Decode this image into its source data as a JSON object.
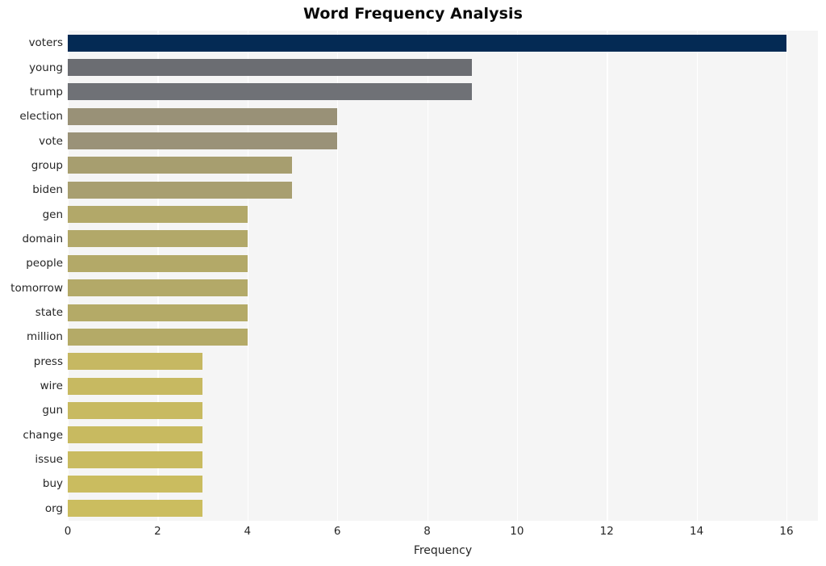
{
  "chart_data": {
    "type": "bar",
    "orientation": "horizontal",
    "title": "Word Frequency Analysis",
    "xlabel": "Frequency",
    "ylabel": "",
    "xlim": [
      0,
      16.7
    ],
    "ylim": [
      0,
      20
    ],
    "grid": true,
    "legend": null,
    "xticks": [
      "0",
      "2",
      "4",
      "6",
      "8",
      "10",
      "12",
      "14",
      "16"
    ],
    "xtick_values": [
      0,
      2,
      4,
      6,
      8,
      10,
      12,
      14,
      16
    ],
    "categories": [
      "voters",
      "young",
      "trump",
      "election",
      "vote",
      "group",
      "biden",
      "gen",
      "domain",
      "people",
      "tomorrow",
      "state",
      "million",
      "press",
      "wire",
      "gun",
      "change",
      "issue",
      "buy",
      "org"
    ],
    "values": [
      16,
      9,
      9,
      6,
      6,
      5,
      5,
      4,
      4,
      4,
      4,
      4,
      4,
      3,
      3,
      3,
      3,
      3,
      3,
      3
    ],
    "bar_colors": [
      "#042a54",
      "#6b6d72",
      "#6f7176",
      "#999177",
      "#9a9278",
      "#a79e6f",
      "#a89f70",
      "#b2a869",
      "#b2a869",
      "#b3a968",
      "#b3a968",
      "#b4aa67",
      "#b4aa67",
      "#c6b862",
      "#c7b961",
      "#c8ba61",
      "#c8ba60",
      "#c9bb60",
      "#cabc5f",
      "#cbbd5f"
    ],
    "plot_bg": "#f5f5f5",
    "grid_color": "#ffffff",
    "figure_bg": "#ffffff"
  }
}
